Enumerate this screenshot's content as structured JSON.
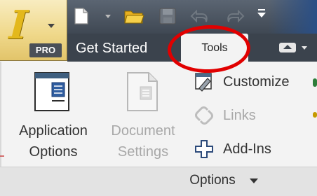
{
  "app": {
    "badge": "PRO",
    "logo_letter": "I"
  },
  "quick_access": {
    "icons": [
      "new-icon",
      "open-icon",
      "save-icon",
      "undo-icon",
      "redo-icon",
      "more-icon"
    ]
  },
  "tabs": [
    {
      "label": "Get Started",
      "active": false
    },
    {
      "label": "Tools",
      "active": true
    }
  ],
  "ribbon": {
    "large_buttons": [
      {
        "label_line1": "Application",
        "label_line2": "Options",
        "enabled": true,
        "icon": "application-options-icon"
      },
      {
        "label_line1": "Document",
        "label_line2": "Settings",
        "enabled": false,
        "icon": "document-settings-icon"
      }
    ],
    "small_buttons": [
      {
        "label": "Customize",
        "enabled": true,
        "icon": "customize-icon"
      },
      {
        "label": "Links",
        "enabled": false,
        "icon": "links-icon"
      },
      {
        "label": "Add-Ins",
        "enabled": true,
        "icon": "add-ins-icon"
      }
    ],
    "panel_title": "Options"
  },
  "colors": {
    "annotation": "#e10000",
    "title_bar": "#4a5360",
    "tab_text": "#ffffff",
    "disabled_text": "#a8a8a8"
  }
}
